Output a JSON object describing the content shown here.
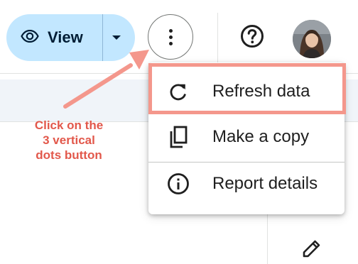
{
  "toolbar": {
    "view_label": "View",
    "view_icon": "eye-icon",
    "dropdown_icon": "caret-down-icon",
    "more_icon": "more-vert-icon",
    "help_icon": "help-icon",
    "avatar_icon": "user-avatar"
  },
  "menu": {
    "items": [
      {
        "label": "Refresh data",
        "icon": "refresh-icon"
      },
      {
        "label": "Make a copy",
        "icon": "copy-icon"
      },
      {
        "label": "Report details",
        "icon": "info-icon"
      }
    ]
  },
  "annotation": {
    "line1": "Click on the",
    "line2": "3 vertical",
    "line3": "dots button"
  },
  "side": {
    "edit_icon": "pencil-icon"
  },
  "colors": {
    "view_button_bg": "#c2e7ff",
    "annotation": "#e2584b",
    "highlight": "#f4978c"
  }
}
